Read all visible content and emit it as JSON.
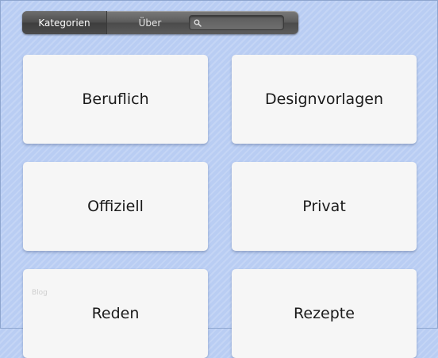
{
  "nav": {
    "tabs": [
      {
        "label": "Kategorien",
        "active": true
      },
      {
        "label": "Über",
        "active": false
      }
    ],
    "search": {
      "placeholder": "",
      "value": "",
      "icon": "search-icon"
    }
  },
  "cards": [
    {
      "label": "Beruflich"
    },
    {
      "label": "Designvorlagen"
    },
    {
      "label": "Offiziell"
    },
    {
      "label": "Privat"
    },
    {
      "label": "Reden"
    },
    {
      "label": "Rezepte"
    }
  ],
  "watermark": "Blog",
  "colors": {
    "background": "#b9cdf3",
    "card": "#f6f6f6",
    "navbar": "#5a5a5a"
  }
}
